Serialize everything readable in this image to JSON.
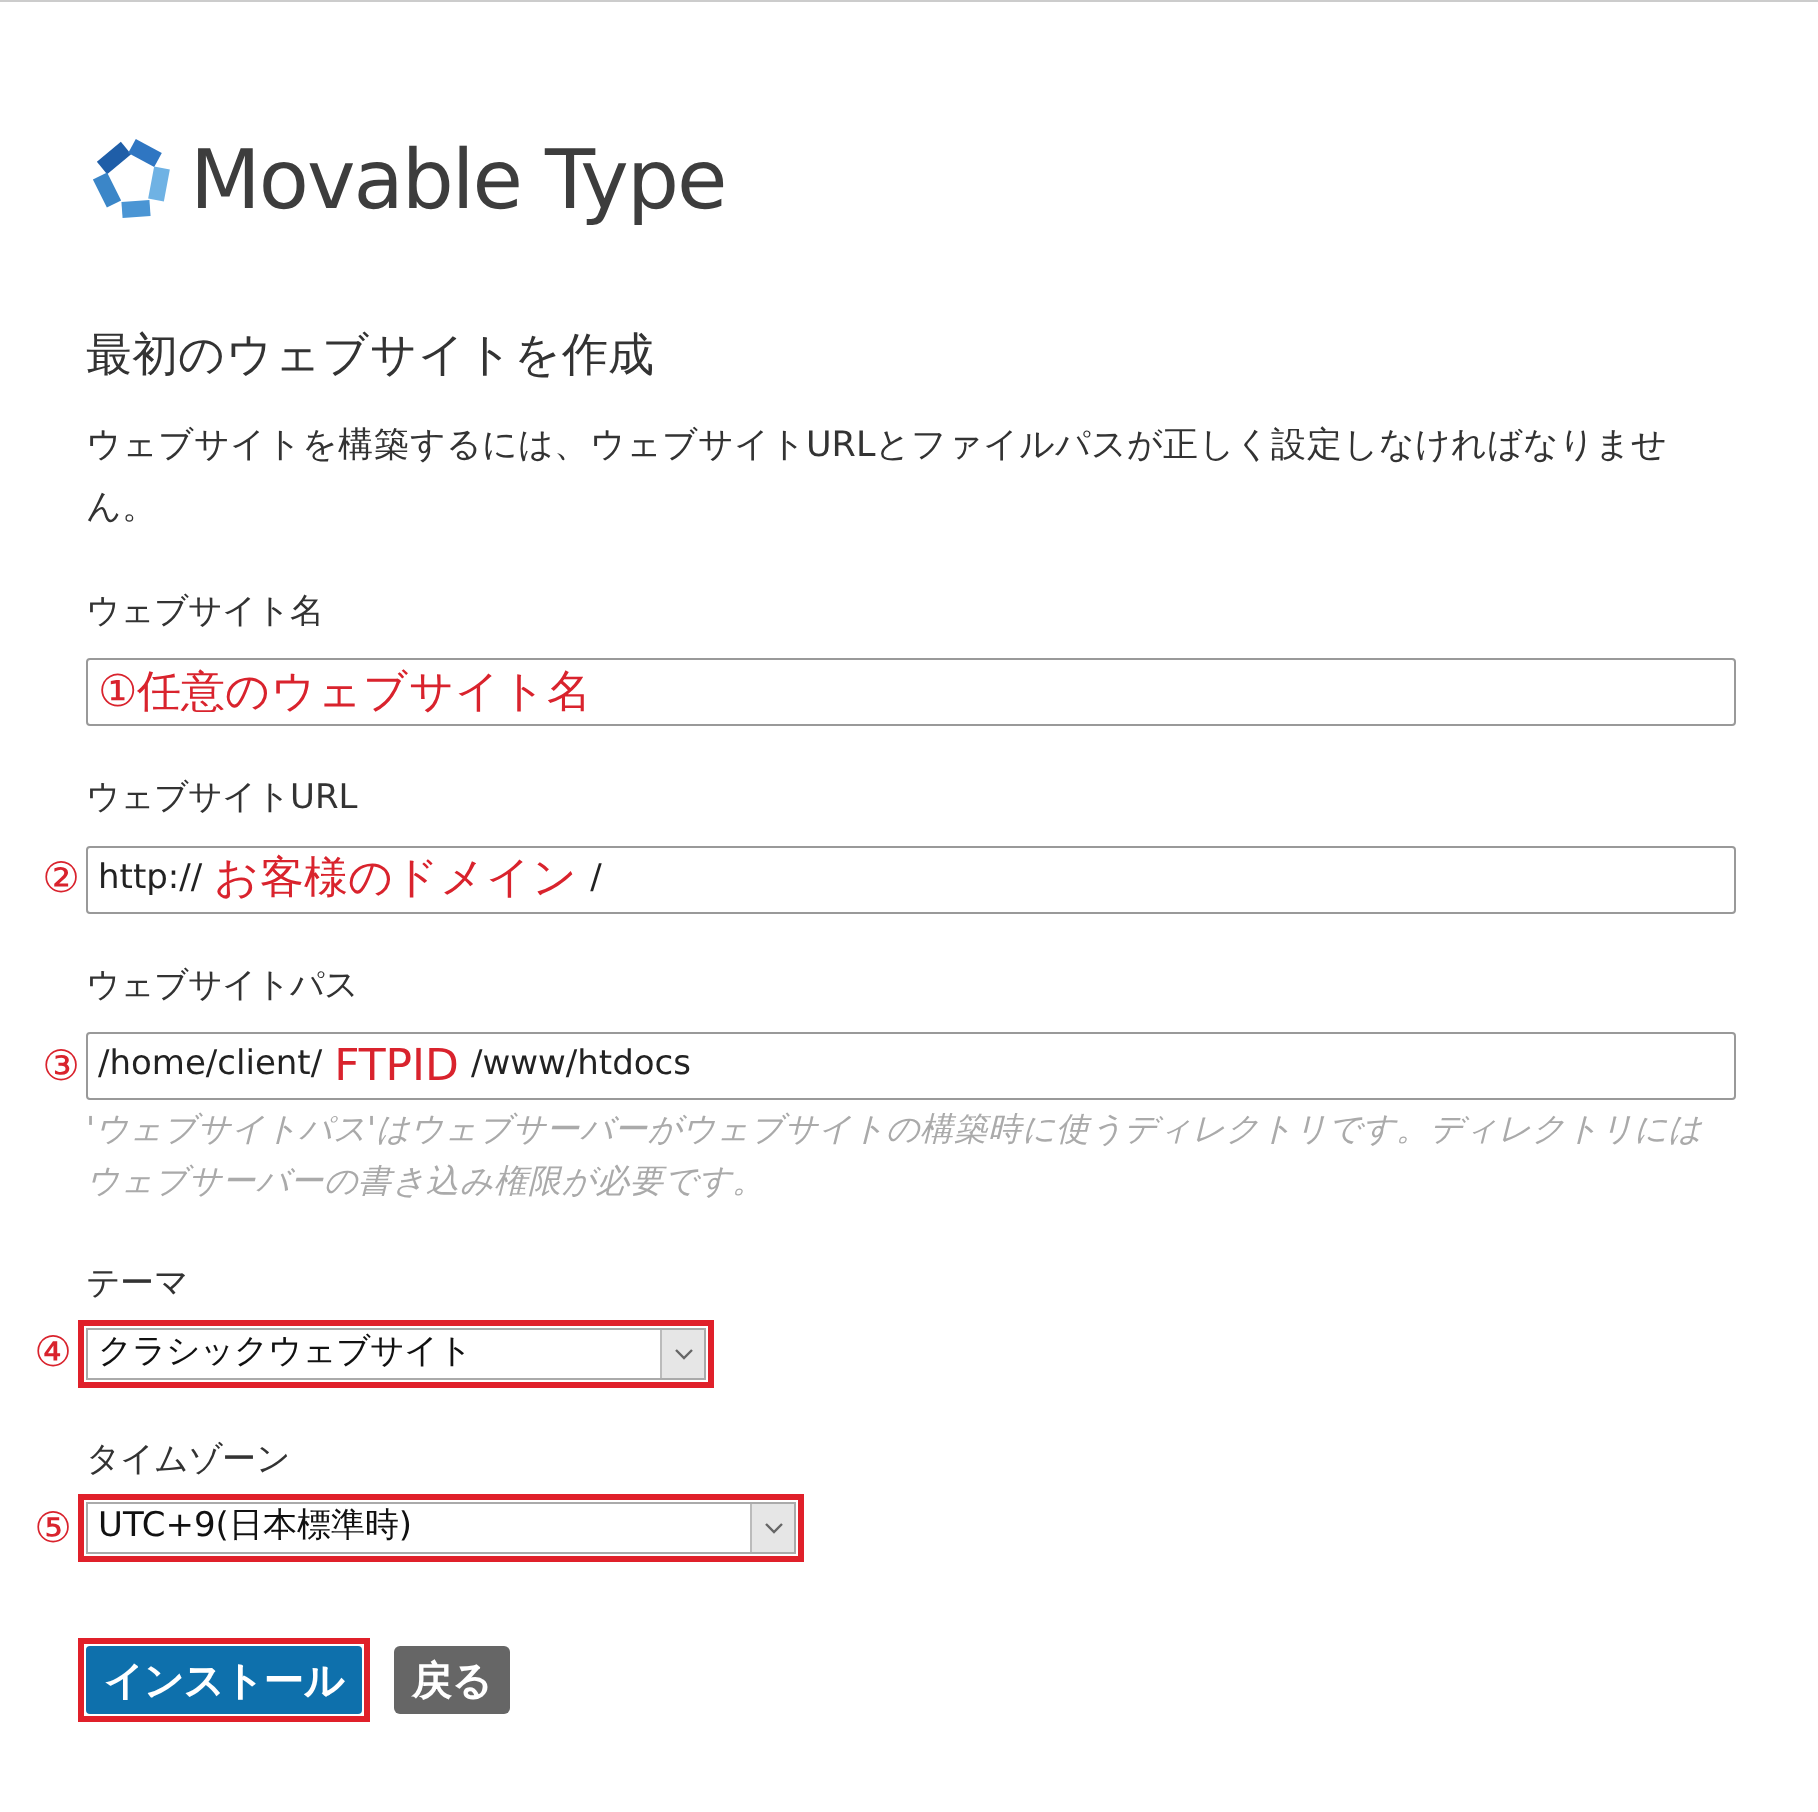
{
  "logo": {
    "text": "Movable Type"
  },
  "heading": "最初のウェブサイトを作成",
  "description": "ウェブサイトを構築するには、ウェブサイトURLとファイルパスが正しく設定しなければなりません。",
  "fields": [
    {
      "label": "ウェブサイト名",
      "segments": [
        {
          "kind": "annotation",
          "text": "①任意のウェブサイト名"
        }
      ]
    },
    {
      "label": "ウェブサイトURL",
      "marker": "②",
      "segments": [
        {
          "kind": "value",
          "text": "http://"
        },
        {
          "kind": "annotation",
          "text": "お客様のドメイン"
        },
        {
          "kind": "value",
          "text": "/"
        }
      ]
    },
    {
      "label": "ウェブサイトパス",
      "marker": "③",
      "segments": [
        {
          "kind": "value",
          "text": "/home/client/"
        },
        {
          "kind": "annotation",
          "text": "FTPID"
        },
        {
          "kind": "value",
          "text": "/www/htdocs"
        }
      ],
      "hint": "'ウェブサイトパス'はウェブサーバーがウェブサイトの構築時に使うディレクトリです。ディレクトリにはウェブサーバーの書き込み権限が必要です。"
    }
  ],
  "selects": [
    {
      "label": "テーマ",
      "marker": "④",
      "value": "クラシックウェブサイト",
      "highlighted": true
    },
    {
      "label": "タイムゾーン",
      "marker": "⑤",
      "value": "UTC+9(日本標準時)",
      "highlighted": true
    }
  ],
  "buttons": [
    {
      "label": "インストール",
      "kind": "primary",
      "highlighted": true
    },
    {
      "label": "戻る",
      "kind": "secondary",
      "highlighted": false
    }
  ]
}
